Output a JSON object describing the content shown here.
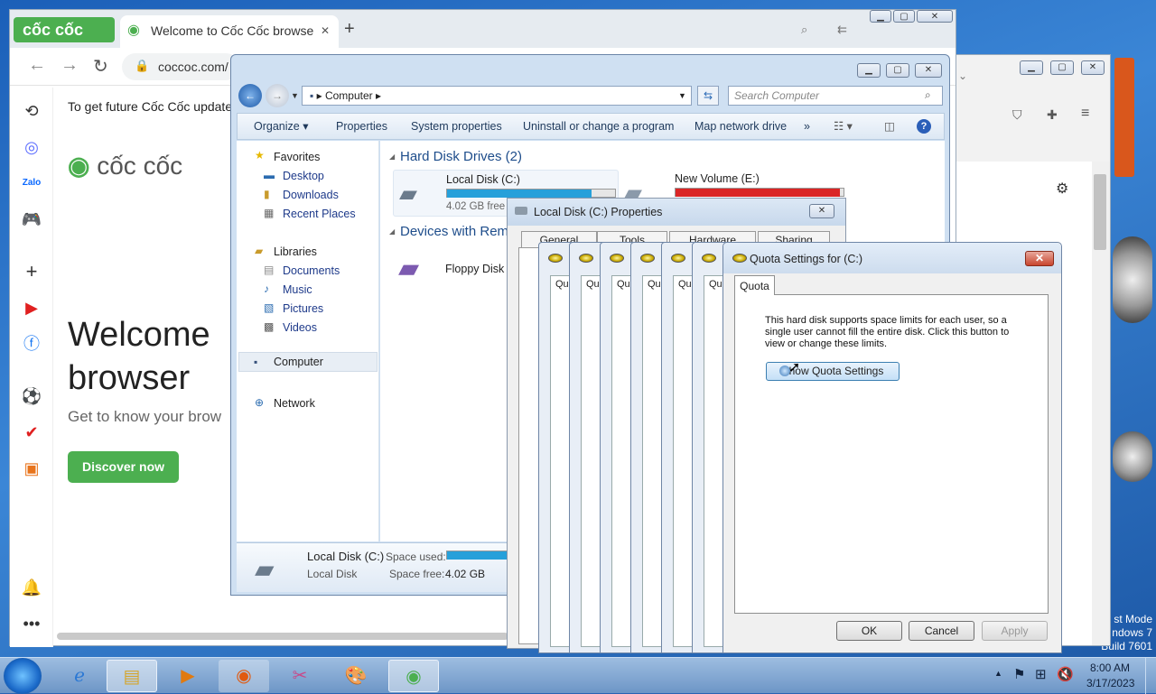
{
  "desktop": {
    "watermark_line1": "st Mode",
    "watermark_line2": "ndows 7",
    "watermark_line3": "Build 7601"
  },
  "browser": {
    "logo_text": "cốc cốc",
    "tab_title": "Welcome to Cốc Cốc browse",
    "tab_close": "✕",
    "new_tab": "+",
    "url": "coccoc.com/",
    "notice": "To get future Cốc Cốc update",
    "brand": "cốc cốc",
    "welcome_line1": "Welcome",
    "welcome_line2": "browser",
    "subtitle": "Get to know your brow",
    "discover_label": "Discover now"
  },
  "explorer": {
    "address_path": "Computer",
    "search_placeholder": "Search Computer",
    "commands": [
      "Organize ▾",
      "Properties",
      "System properties",
      "Uninstall or change a program",
      "Map network drive",
      "»"
    ],
    "nav": {
      "favorites": "Favorites",
      "desktop": "Desktop",
      "downloads": "Downloads",
      "recent": "Recent Places",
      "libraries": "Libraries",
      "documents": "Documents",
      "music": "Music",
      "pictures": "Pictures",
      "videos": "Videos",
      "computer": "Computer",
      "network": "Network"
    },
    "group_hdd": "Hard Disk Drives (2)",
    "group_removable": "Devices with Rem",
    "drive_c_name": "Local Disk (C:)",
    "drive_c_free": "4.02 GB free o",
    "drive_c_used_fraction": 0.86,
    "drive_e_name": "New Volume (E:)",
    "drive_e_used_fraction": 0.98,
    "floppy_name": "Floppy Disk D",
    "details": {
      "name": "Local Disk (C:)",
      "type": "Local Disk",
      "used_label": "Space used:",
      "free_label": "Space free:",
      "free_value": "4.02 GB"
    }
  },
  "properties": {
    "title": "Local Disk (C:) Properties",
    "tabs": [
      "General",
      "Tools",
      "Hardware",
      "Sharing"
    ]
  },
  "quota": {
    "stack_label": "Qu",
    "title": "Quota Settings for  (C:)",
    "tab": "Quota",
    "text": "This hard disk supports space limits for each user, so a single user cannot fill the entire disk. Click this button to view or change these limits.",
    "button": "Show Quota Settings",
    "ok": "OK",
    "cancel": "Cancel",
    "apply": "Apply"
  },
  "taskbar": {
    "time": "8:00 AM",
    "date": "3/17/2023"
  },
  "colors": {
    "coccoc_green": "#4caf50",
    "drive_bar_normal": "#26a0da",
    "drive_bar_full": "#da2626"
  }
}
